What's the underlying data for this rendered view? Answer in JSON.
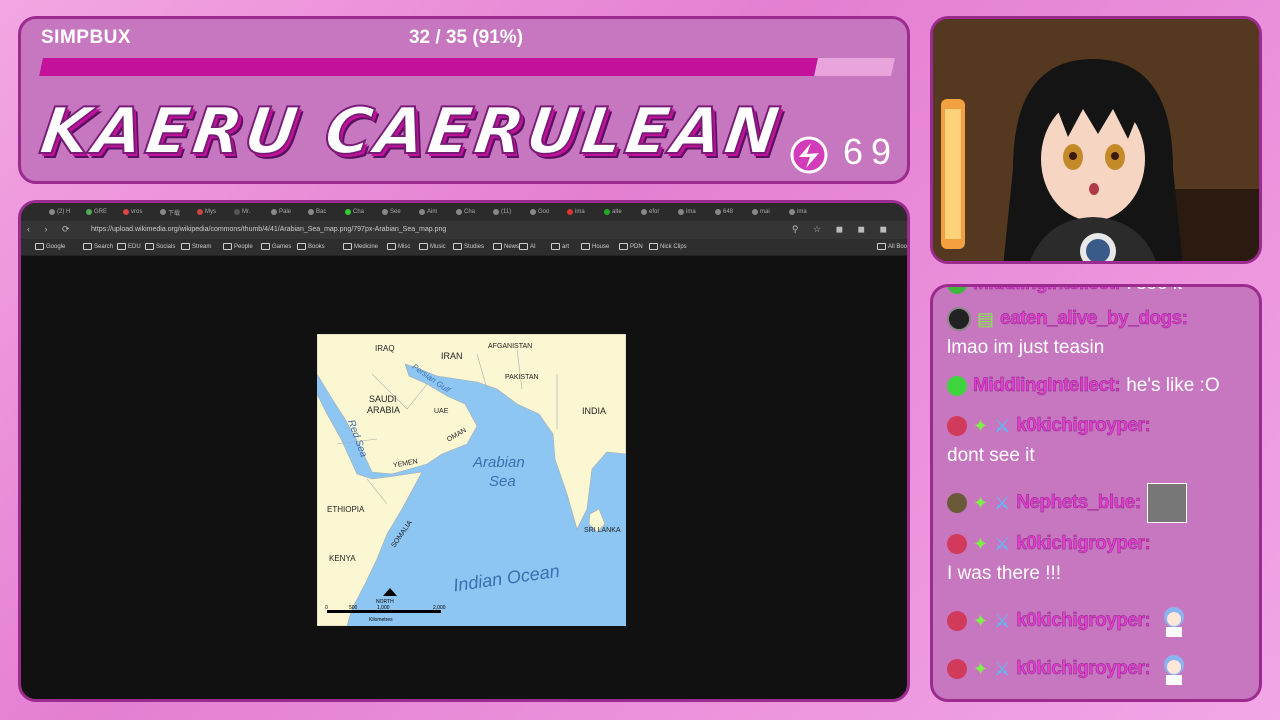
{
  "header": {
    "currency_label": "SIMPBUX",
    "progress_text": "32 / 35 (91%)",
    "progress_fraction": 0.91,
    "title": "KAERU CAERULEAN",
    "coin_count": "69"
  },
  "browser": {
    "url": "https://upload.wikimedia.org/wikipedia/commons/thumb/4/41/Arabian_Sea_map.png/797px-Arabian_Sea_map.png",
    "tabs": [
      "(2) H",
      "GRE",
      "vros",
      "下载",
      "Mys",
      "Mr.",
      "Pale",
      "Bac",
      "Cha",
      "See",
      "Aim",
      "Cha",
      "(11)",
      "Goo",
      "ima",
      "alte",
      "efor",
      "ima",
      "648",
      "mai",
      "ima"
    ],
    "bookmarks": [
      "Google",
      "Search",
      "EDU",
      "Socials",
      "Stream",
      "People",
      "Games",
      "Books",
      "Medicine",
      "Misc",
      "Music",
      "Studies",
      "News",
      "AI",
      "art",
      "House",
      "PDN",
      "Nick Clips",
      "All Boo"
    ]
  },
  "map": {
    "labels": {
      "iraq": "IRAQ",
      "iran": "IRAN",
      "afganistan": "AFGANISTAN",
      "pakistan": "PAKISTAN",
      "saudi": "SAUDI",
      "arabia": "ARABIA",
      "uae": "UAE",
      "oman": "OMAN",
      "india": "INDIA",
      "yemen": "YEMEN",
      "ethiopia": "ETHIOPIA",
      "somalia": "SOMALIA",
      "kenya": "KENYA",
      "srilanka": "SRI LANKA",
      "persian_gulf": "Persian Gulf",
      "red_sea": "Red Sea",
      "arabian": "Arabian",
      "sea": "Sea",
      "indian_ocean": "Indian Ocean",
      "north": "NORTH",
      "scale_0": "0",
      "scale_500": "500",
      "scale_1000": "1,000",
      "scale_2000": "2,000",
      "km": "Kilometres"
    }
  },
  "chat": {
    "messages": [
      {
        "user": "MiddlingIntellect:",
        "text": "I see it"
      },
      {
        "user": "eaten_alive_by_dogs:",
        "text": "lmao im just teasin"
      },
      {
        "user": "MiddlingIntellect:",
        "text": "he's like :O"
      },
      {
        "user": "k0kichigroyper:",
        "text": "dont see it"
      },
      {
        "user": "Nephets_blue:",
        "text": ""
      },
      {
        "user": "k0kichigroyper:",
        "text": "I was there !!!"
      },
      {
        "user": "k0kichigroyper:",
        "text": ""
      },
      {
        "user": "k0kichigroyper:",
        "text": ""
      }
    ]
  },
  "colors": {
    "accent": "#c4119c",
    "panel": "#c777c0",
    "border": "#9c2b8f",
    "username": "#e33dd0",
    "sea": "#8ec6f3",
    "land": "#fbf7d3"
  }
}
